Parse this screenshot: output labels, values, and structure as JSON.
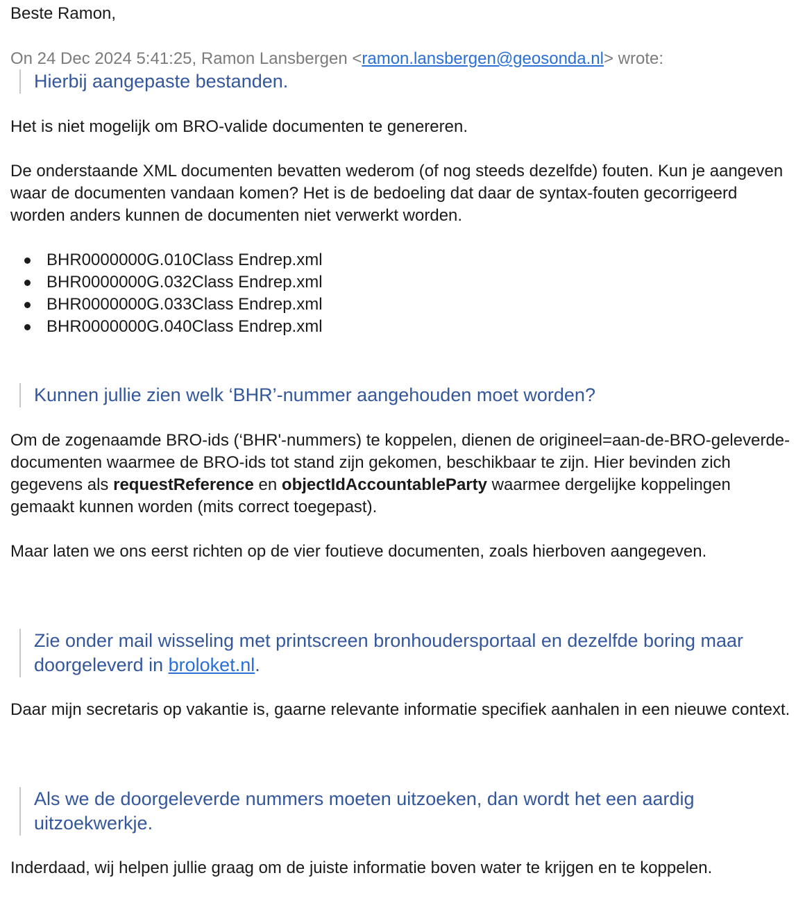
{
  "greeting": "Beste Ramon,",
  "header": {
    "prefix": "On 24 Dec 2024 5:41:25, Ramon Lansbergen <",
    "email": "ramon.lansbergen@geosonda.nl",
    "suffix": "> wrote:"
  },
  "quote1": "Hierbij aangepaste bestanden.",
  "para1": "Het is niet mogelijk om BRO-valide documenten te genereren.",
  "para2": "De onderstaande XML documenten bevatten wederom (of nog steeds dezelfde) fouten. Kun je aangeven waar de documenten vandaan komen? Het is de bedoeling dat daar de syntax-fouten gecorrigeerd worden anders kunnen de documenten niet verwerkt worden.",
  "files": [
    "BHR0000000G.010Class Endrep.xml",
    "BHR0000000G.032Class Endrep.xml",
    "BHR0000000G.033Class Endrep.xml",
    "BHR0000000G.040Class Endrep.xml"
  ],
  "quote2": "Kunnen jullie zien welk ‘BHR’-nummer aangehouden moet worden?",
  "para3": {
    "part1": "Om de zogenaamde BRO-ids (‘BHR'-nummers) te koppelen, dienen de origineel=aan-de-BRO-geleverde-documenten waarmee de BRO-ids tot stand zijn gekomen, beschikbaar te zijn. Hier bevinden zich gegevens als ",
    "bold1": "requestReference",
    "mid": " en ",
    "bold2": "objectIdAccountableParty",
    "part2": " waarmee dergelijke koppelingen gemaakt kunnen worden (mits correct toegepast)."
  },
  "para4": "Maar laten we ons eerst richten op de vier foutieve documenten, zoals hierboven aangegeven.",
  "quote3": {
    "text": "Zie onder mail wisseling met printscreen bronhoudersportaal en dezelfde boring maar doorgeleverd in ",
    "link": "broloket.nl",
    "end": "."
  },
  "para5": "Daar mijn secretaris op vakantie is, gaarne relevante informatie specifiek aanhalen in een nieuwe context.",
  "quote4": "Als we de doorgeleverde nummers moeten uitzoeken, dan wordt het een aardig uitzoekwerkje.",
  "para6": "Inderdaad, wij helpen jullie graag om de juiste informatie boven water te krijgen en te koppelen."
}
